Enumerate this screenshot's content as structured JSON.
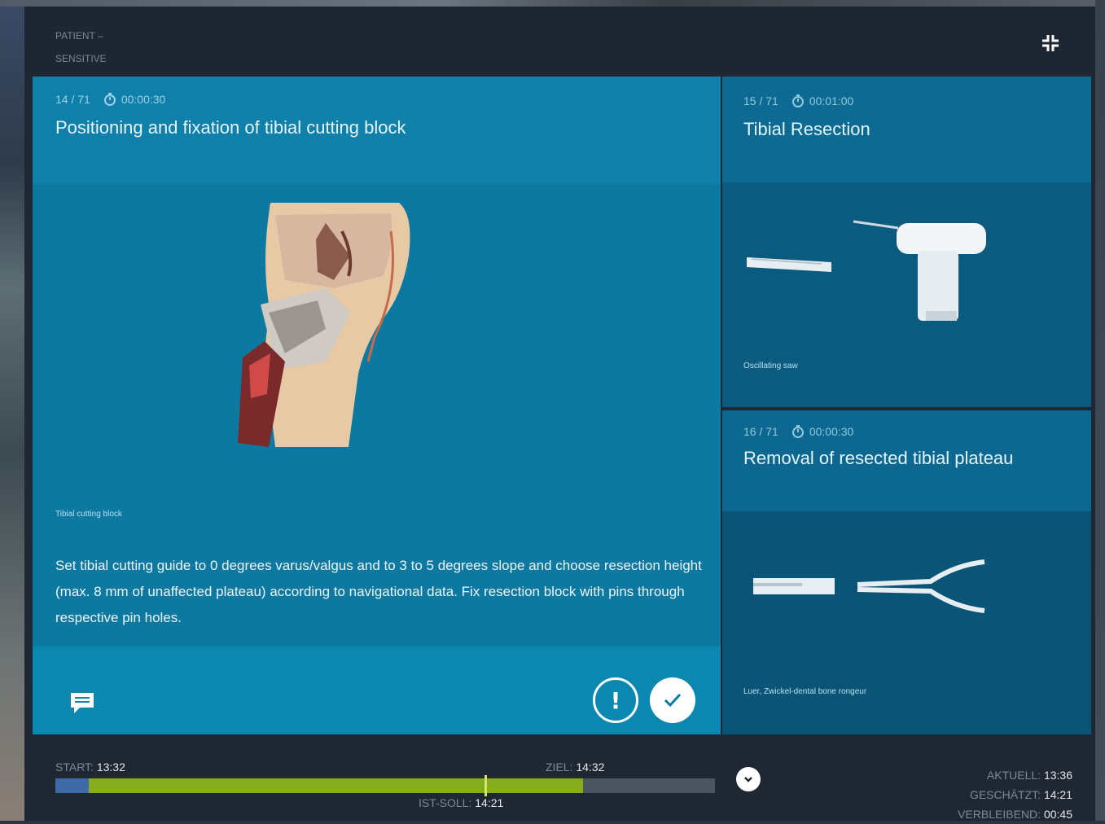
{
  "header": {
    "patient_label": "PATIENT –",
    "patient_sub": "SENSITIVE",
    "expand_icon": "expand-icon"
  },
  "current_step": {
    "counter": "14 / 71",
    "duration": "00:00:30",
    "title": "Positioning and fixation of tibial cutting block",
    "image_caption": "Tibial cutting block",
    "instructions": "Set tibial cutting guide to 0 degrees varus/valgus and to 3 to 5 degrees slope and choose resection height (max. 8 mm of unaffected plateau) according to navigational data. Fix resection block with pins through respective pin holes.",
    "comment_icon": "comment-icon",
    "warning_icon": "exclamation-icon",
    "done_icon": "checkmark-icon"
  },
  "next_steps": [
    {
      "counter": "15 / 71",
      "duration": "00:01:00",
      "title": "Tibial Resection",
      "caption": "Oscillating saw"
    },
    {
      "counter": "16 / 71",
      "duration": "00:00:30",
      "title": "Removal of resected tibial plateau",
      "caption": "Luer, Zwickel-dental bone rongeur"
    }
  ],
  "timeline": {
    "start_label": "START:",
    "start_time": "13:32",
    "target_label": "ZIEL:",
    "target_time": "14:32",
    "actual_label": "IST-SOLL:",
    "actual_time": "14:21",
    "progress": 0.8,
    "marker": 0.65,
    "start_block": 0.05,
    "colors": {
      "progress": "#86ad1e",
      "start": "#3f6aa8",
      "track": "#4b5560"
    }
  },
  "stats": {
    "current_label": "AKTUELL:",
    "current_value": "13:36",
    "estimated_label": "GESCHÄTZT:",
    "estimated_value": "14:21",
    "remaining_label": "VERBLEIBEND:",
    "remaining_value": "00:45"
  }
}
